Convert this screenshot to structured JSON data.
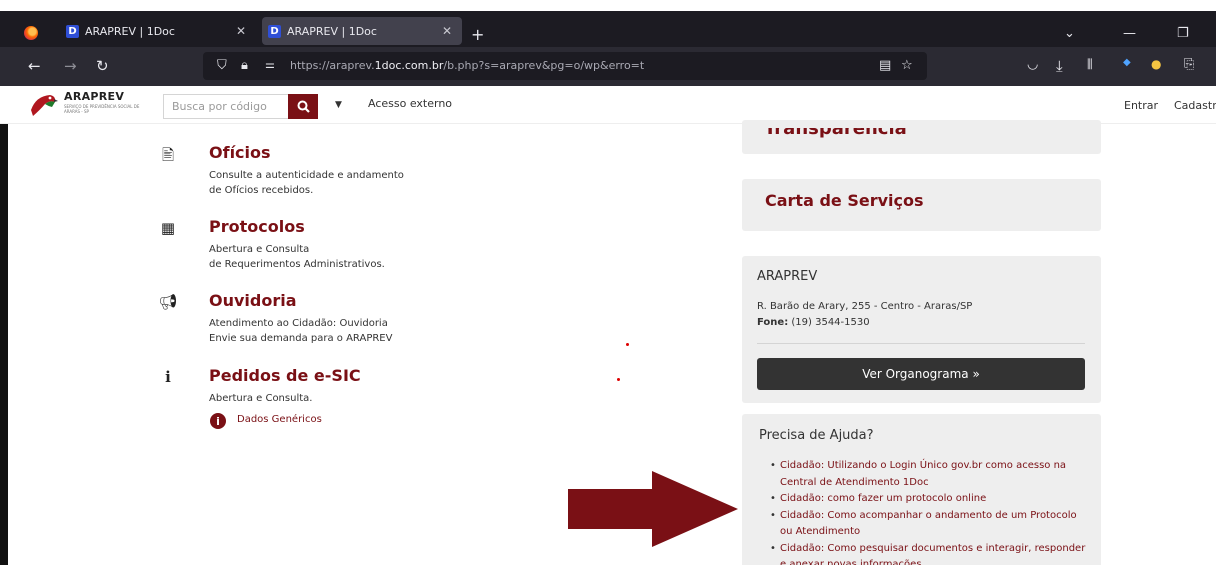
{
  "browser": {
    "tabs": [
      {
        "title": "ARAPREV | 1Doc",
        "favicon": "D",
        "active": false
      },
      {
        "title": "ARAPREV | 1Doc",
        "favicon": "D",
        "active": true
      }
    ],
    "url_prefix": "https://araprev.",
    "url_domain": "1doc.com.br",
    "url_suffix": "/b.php?s=araprev&pg=o/wp&erro=t"
  },
  "header": {
    "logo_name": "ARAPREV",
    "logo_sub": "SERVIÇO DE PREVIDÊNCIA SOCIAL DE ARARAS - SP",
    "search_placeholder": "Busca por código",
    "externo": "Acesso externo",
    "entrar": "Entrar",
    "cadastro": "Cadastro"
  },
  "services": [
    {
      "name": "Ofícios",
      "icon": "document-icon",
      "desc1": "Consulte a autenticidade e andamento",
      "desc2": "de Ofícios recebidos."
    },
    {
      "name": "Protocolos",
      "icon": "qrcode-icon",
      "desc1": "Abertura e Consulta",
      "desc2": "de Requerimentos Administrativos."
    },
    {
      "name": "Ouvidoria",
      "icon": "megaphone-icon",
      "desc1": "Atendimento ao Cidadão: Ouvidoria",
      "desc2": "Envie sua demanda para o ARAPREV"
    },
    {
      "name": "Pedidos de e-SIC",
      "icon": "info-icon",
      "desc1": "Abertura e Consulta.",
      "desc2": ""
    }
  ],
  "dados_genericos": "Dados Genéricos",
  "sidebar": {
    "transparencia": "Transparência",
    "carta": "Carta de Serviços",
    "araprev_title": "ARAPREV",
    "address": "R. Barão de Arary, 255 - Centro - Araras/SP",
    "fone_label": "Fone:",
    "fone_value": "(19) 3544-1530",
    "organograma": "Ver Organograma »",
    "help_title": "Precisa de Ajuda?",
    "help_items": [
      "Cidadão: Utilizando o Login Único gov.br como acesso na Central de Atendimento 1Doc",
      "Cidadão: como fazer um protocolo online",
      "Cidadão: Como acompanhar o andamento de um Protocolo ou Atendimento",
      "Cidadão: Como pesquisar documentos e interagir, responder e anexar novas informações"
    ]
  }
}
